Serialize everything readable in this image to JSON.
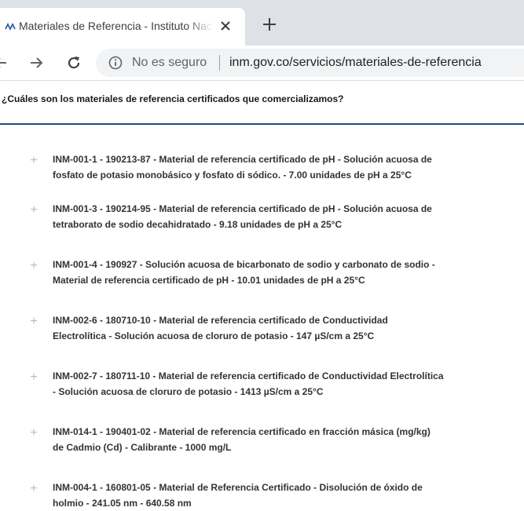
{
  "browser": {
    "tab_title": "Materiales de Referencia - Instituto Nacional de Metrología",
    "security_label": "No es seguro",
    "url": "inm.gov.co/servicios/materiales-de-referencia"
  },
  "page": {
    "question": "¿Cuáles son los materiales de referencia certificados que comercializamos?",
    "items": [
      {
        "line1": "INM-001-1 - 190213-87 - Material de referencia certificado de pH - Solución acuosa de",
        "line2": "fosfato de potasio monobásico y fosfato di sódico. - 7.00 unidades de pH a 25°C"
      },
      {
        "line1": "INM-001-3 - 190214-95 - Material de referencia certificado de pH - Solución acuosa de",
        "line2": "tetraborato de sodio decahidratado - 9.18 unidades de pH a 25°C"
      },
      {
        "line1": "INM-001-4 - 190927 - Solución acuosa de bicarbonato de sodio y carbonato de sodio -",
        "line2": "Material de referencia certificado de pH - 10.01 unidades de pH a 25°C"
      },
      {
        "line1": "INM-002-6 - 180710-10 - Material de referencia certificado de Conductividad",
        "line2": "Electrolítica - Solución acuosa de cloruro de potasio - 147 µS/cm a 25°C"
      },
      {
        "line1": "INM-002-7 - 180711-10 - Material de referencia certificado de Conductividad Electrolítica",
        "line2": "- Solución acuosa de cloruro de potasio - 1413 µS/cm a 25°C"
      },
      {
        "line1": "INM-014-1 - 190401-02 - Material de referencia certificado en fracción másica (mg/kg)",
        "line2": "de Cadmio (Cd) - Calibrante - 1000 mg/L"
      },
      {
        "line1": "INM-004-1 - 160801-05 - Material de Referencia Certificado - Disolución de óxido de",
        "line2": "holmio - 241.05 nm - 640.58 nm"
      }
    ]
  }
}
